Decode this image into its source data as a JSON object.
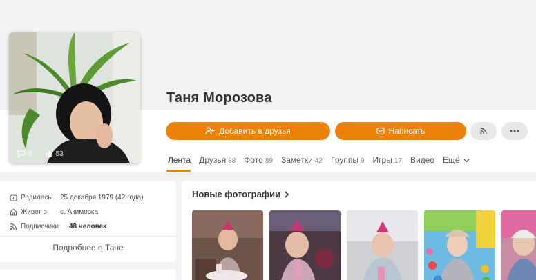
{
  "profile": {
    "name": "Таня Морозова",
    "avatar_stats": {
      "comments": "0",
      "likes": "53"
    }
  },
  "actions": {
    "add_friend": "Добавить в друзья",
    "message": "Написать"
  },
  "tabs": [
    {
      "label": "Лента",
      "count": ""
    },
    {
      "label": "Друзья",
      "count": "88"
    },
    {
      "label": "Фото",
      "count": "89"
    },
    {
      "label": "Заметки",
      "count": "42"
    },
    {
      "label": "Группы",
      "count": "9"
    },
    {
      "label": "Игры",
      "count": "17"
    },
    {
      "label": "Видео",
      "count": ""
    },
    {
      "label": "Ещё",
      "count": ""
    }
  ],
  "info": {
    "born_label": "Родилась",
    "born_value": "25 декабря 1979 (42 года)",
    "lives_label": "Живет в",
    "lives_value": "с. Акимовка",
    "subs_label": "Подписчики",
    "subs_value": "48 человек",
    "more_link": "Подробнее о Тане"
  },
  "photos": {
    "title": "Новые фотографии"
  },
  "colors": {
    "accent": "#ee8208",
    "background": "#f2f2f2",
    "card": "#ffffff"
  }
}
